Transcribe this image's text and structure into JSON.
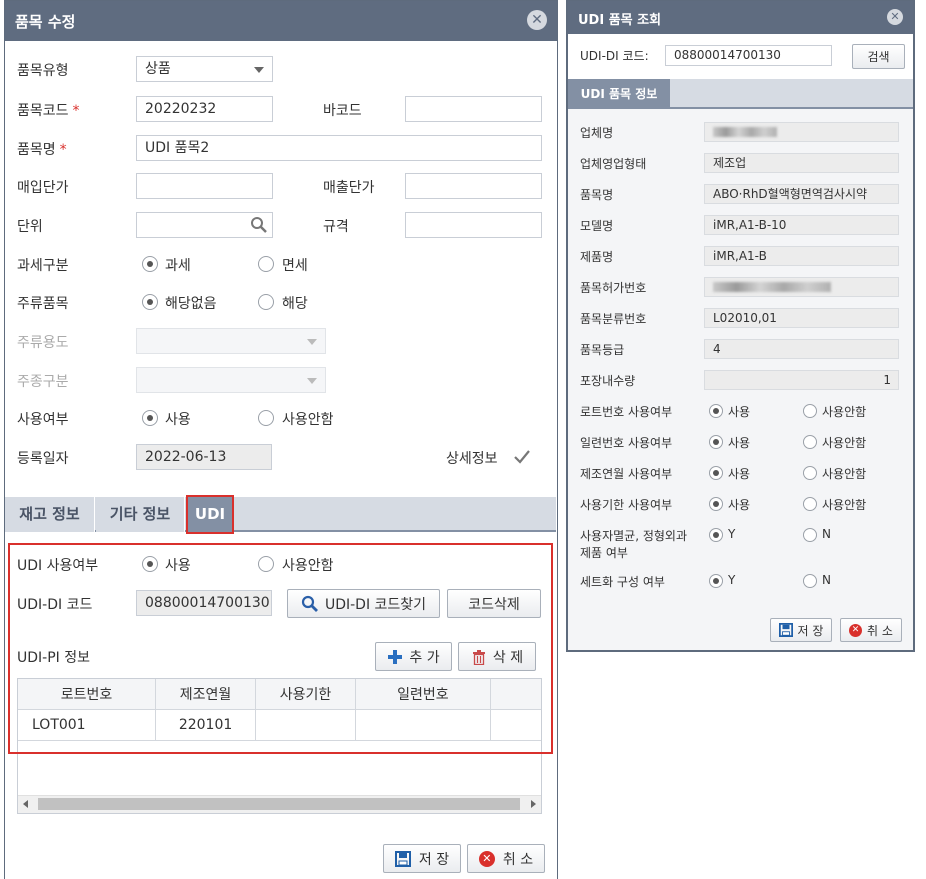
{
  "left": {
    "title": "품목 수정",
    "fields": {
      "type_label": "품목유형",
      "type_value": "상품",
      "code_label": "품목코드",
      "code_value": "20220232",
      "barcode_label": "바코드",
      "barcode_value": "",
      "name_label": "품목명",
      "name_value": "UDI 품목2",
      "buy_price_label": "매입단가",
      "buy_price_value": "",
      "sell_price_label": "매출단가",
      "sell_price_value": "",
      "unit_label": "단위",
      "unit_value": "",
      "spec_label": "규격",
      "spec_value": "",
      "tax_label": "과세구분",
      "tax_opt1": "과세",
      "tax_opt2": "면세",
      "liquor_label": "주류품목",
      "liquor_opt1": "해당없음",
      "liquor_opt2": "해당",
      "liquor_use_label": "주류용도",
      "liquor_kind_label": "주종구분",
      "use_label": "사용여부",
      "use_opt1": "사용",
      "use_opt2": "사용안함",
      "reg_date_label": "등록일자",
      "reg_date_value": "2022-06-13",
      "detail_label": "상세정보"
    },
    "tabs": [
      "재고 정보",
      "기타 정보",
      "UDI"
    ],
    "udi": {
      "use_label": "UDI 사용여부",
      "use_opt1": "사용",
      "use_opt2": "사용안함",
      "di_label": "UDI-DI 코드",
      "di_value": "08800014700130",
      "find_button": "UDI-DI 코드찾기",
      "delete_code_button": "코드삭제",
      "pi_label": "UDI-PI 정보",
      "add_button": "추 가",
      "delete_button": "삭 제",
      "columns": [
        "로트번호",
        "제조연월",
        "사용기한",
        "일련번호",
        ""
      ],
      "rows": [
        [
          "LOT001",
          "220101",
          "",
          "",
          ""
        ]
      ]
    },
    "save_button": "저 장",
    "cancel_button": "취 소"
  },
  "right": {
    "title": "UDI 품목 조회",
    "di_label": "UDI-DI 코드:",
    "di_value": "08800014700130",
    "search_button": "검색",
    "section_tab": "UDI 품목 정보",
    "info": [
      {
        "label": "업체명",
        "value": ""
      },
      {
        "label": "업체영업형태",
        "value": "제조업"
      },
      {
        "label": "품목명",
        "value": "ABO·RhD혈액형면역검사시약"
      },
      {
        "label": "모델명",
        "value": "iMR,A1-B-10"
      },
      {
        "label": "제품명",
        "value": "iMR,A1-B"
      },
      {
        "label": "품목허가번호",
        "value": ""
      },
      {
        "label": "품목분류번호",
        "value": "L02010,01"
      },
      {
        "label": "품목등급",
        "value": "4"
      },
      {
        "label": "포장내수량",
        "value": "1"
      }
    ],
    "flags": [
      {
        "label": "로트번호 사용여부",
        "opt1": "사용",
        "opt2": "사용안함"
      },
      {
        "label": "일련번호 사용여부",
        "opt1": "사용",
        "opt2": "사용안함"
      },
      {
        "label": "제조연월 사용여부",
        "opt1": "사용",
        "opt2": "사용안함"
      },
      {
        "label": "사용기한 사용여부",
        "opt1": "사용",
        "opt2": "사용안함"
      },
      {
        "label1": "사용자멸균, 정형외과",
        "label2": "제품 여부",
        "opt1": "Y",
        "opt2": "N"
      },
      {
        "label": "세트화 구성 여부",
        "opt1": "Y",
        "opt2": "N"
      }
    ],
    "save_button": "저 장",
    "cancel_button": "취 소"
  },
  "colors": {
    "titlebar": "#5f6c80",
    "highlight": "#d9302c",
    "tab_active": "#8390a4"
  }
}
